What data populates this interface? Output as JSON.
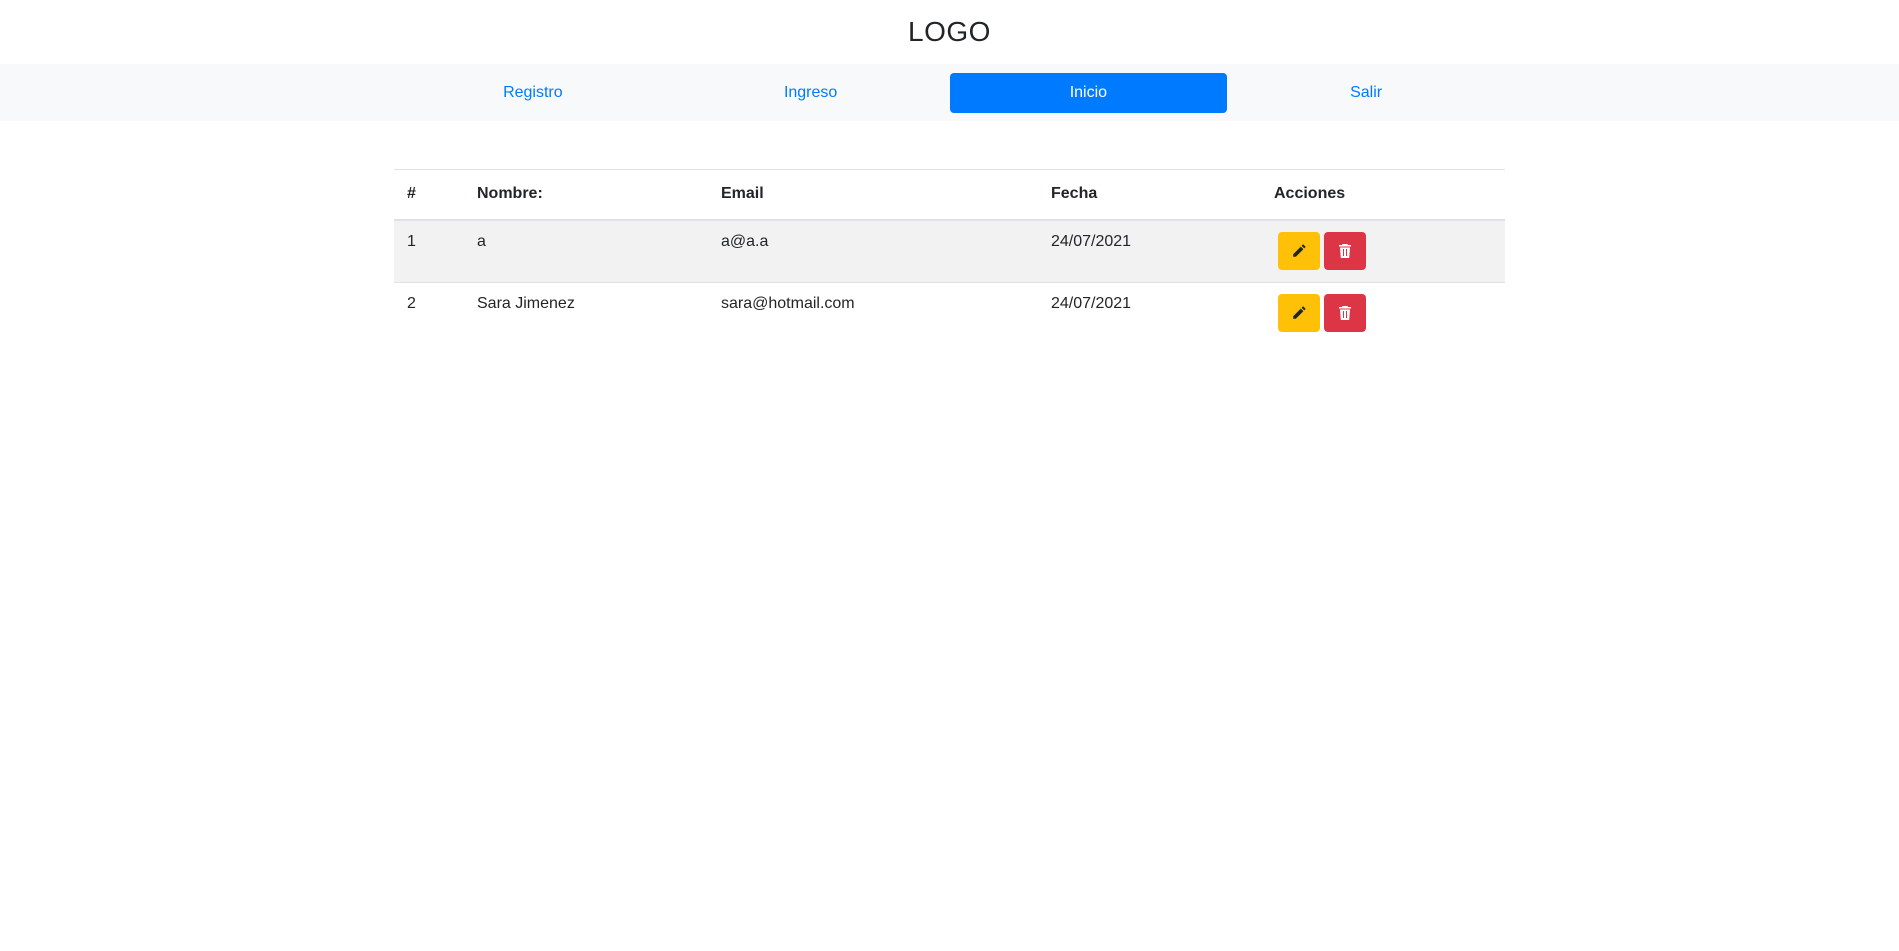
{
  "header": {
    "logo": "LOGO"
  },
  "nav": {
    "items": [
      {
        "label": "Registro"
      },
      {
        "label": "Ingreso"
      },
      {
        "label": "Inicio"
      },
      {
        "label": "Salir"
      }
    ],
    "active": "Inicio"
  },
  "table": {
    "headers": [
      "#",
      "Nombre:",
      "Email",
      "Fecha",
      "Acciones"
    ],
    "rows": [
      {
        "num": "1",
        "name": "a",
        "email": "a@a.a",
        "date": "24/07/2021"
      },
      {
        "num": "2",
        "name": "Sara Jimenez",
        "email": "sara@hotmail.com",
        "date": "24/07/2021"
      }
    ]
  },
  "icons": {
    "edit": "pencil-icon",
    "delete": "trash-icon"
  },
  "colors": {
    "primary": "#007bff",
    "edit_button": "#ffc107",
    "delete_button": "#dc3545",
    "nav_background": "#f8f9fa",
    "striped_row": "#f2f2f2"
  }
}
